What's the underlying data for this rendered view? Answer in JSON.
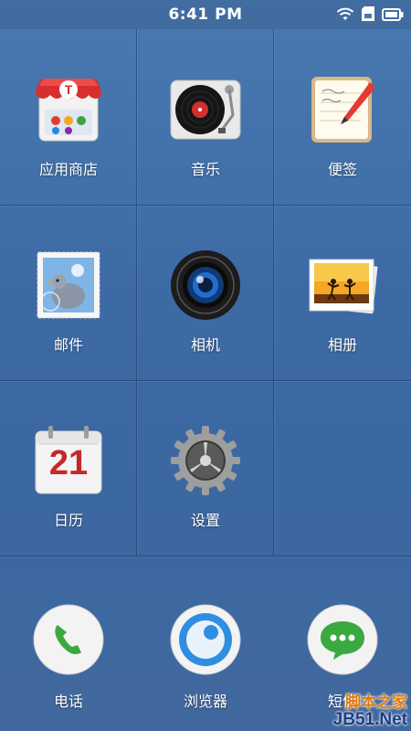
{
  "status_bar": {
    "time": "6:41 PM",
    "icons": [
      "wifi-icon",
      "sd-card-icon",
      "battery-icon"
    ]
  },
  "apps": [
    {
      "label": "应用商店",
      "icon": "app-store-icon"
    },
    {
      "label": "音乐",
      "icon": "music-turntable-icon"
    },
    {
      "label": "便签",
      "icon": "notepad-icon"
    },
    {
      "label": "邮件",
      "icon": "mail-stamp-icon"
    },
    {
      "label": "相机",
      "icon": "camera-lens-icon"
    },
    {
      "label": "相册",
      "icon": "photo-album-icon"
    },
    {
      "label": "日历",
      "icon": "calendar-icon"
    },
    {
      "label": "设置",
      "icon": "settings-gear-icon"
    }
  ],
  "calendar_day": "21",
  "dock": [
    {
      "label": "电话",
      "icon": "phone-icon"
    },
    {
      "label": "浏览器",
      "icon": "browser-icon"
    },
    {
      "label": "短信",
      "icon": "sms-icon"
    }
  ],
  "watermark": {
    "line1": "脚本之家",
    "line2": "JB51.Net"
  }
}
